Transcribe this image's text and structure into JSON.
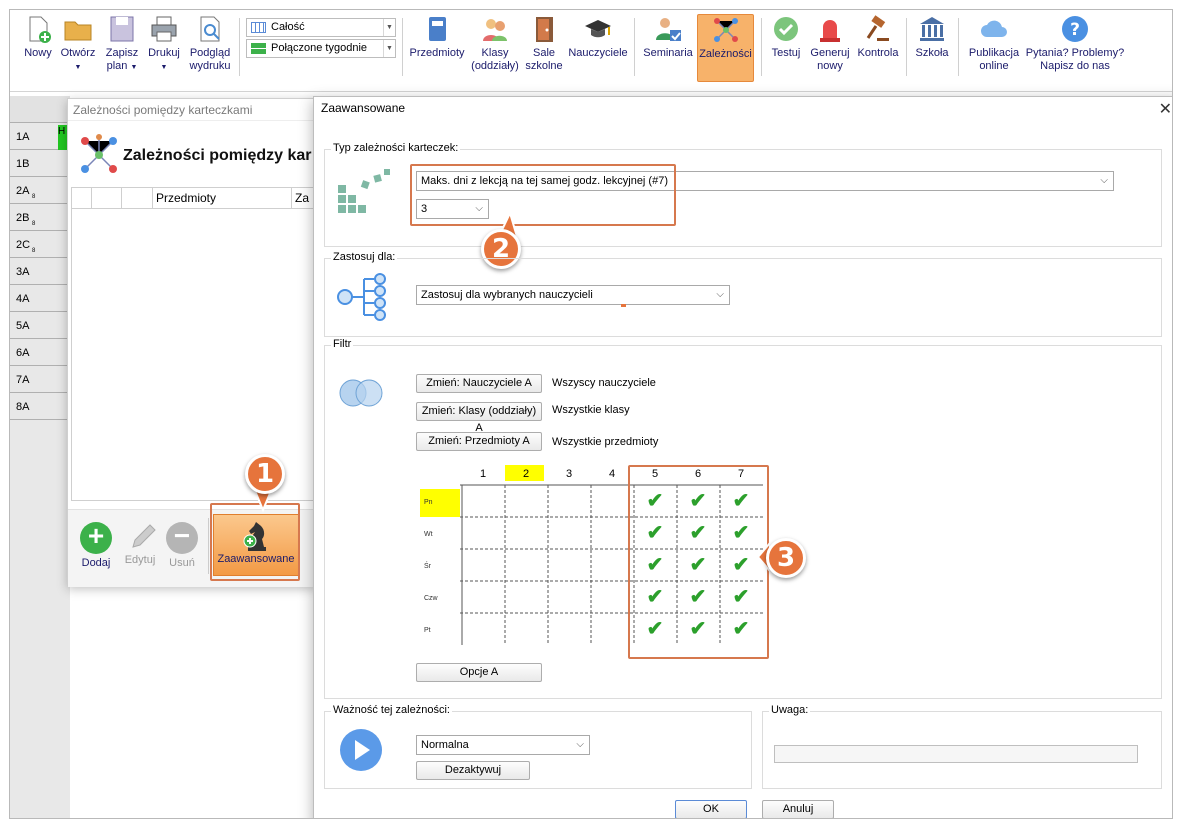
{
  "toolbar": {
    "nowy": "Nowy",
    "otworz": "Otwórz",
    "zapisz_line1": "Zapisz",
    "zapisz_line2": "plan",
    "drukuj": "Drukuj",
    "podglad_line1": "Podgląd",
    "podglad_line2": "wydruku",
    "combo1": "Całość",
    "combo2": "Połączone tygodnie",
    "przedmioty": "Przedmioty",
    "klasy_line1": "Klasy",
    "klasy_line2": "(oddziały)",
    "sale_line1": "Sale",
    "sale_line2": "szkolne",
    "nauczyciele": "Nauczyciele",
    "seminaria": "Seminaria",
    "zaleznosci": "Zależności",
    "testuj": "Testuj",
    "generuj_line1": "Generuj",
    "generuj_line2": "nowy",
    "kontrola": "Kontrola",
    "szkola": "Szkoła",
    "publikacja_line1": "Publikacja",
    "publikacja_line2": "online",
    "pytania_line1": "Pytania? Problemy?",
    "pytania_line2": "Napisz do nas"
  },
  "classes": [
    "1A",
    "1B",
    "2A",
    "2B",
    "2C",
    "3A",
    "4A",
    "5A",
    "6A",
    "7A",
    "8A"
  ],
  "class_subs": {
    "2A": "8",
    "2B": "8",
    "2C": "8"
  },
  "dialog1": {
    "title": "Zależności pomiędzy karteczkami",
    "heading": "Zależności pomiędzy kar",
    "col_przedmioty": "Przedmioty",
    "col_za": "Za",
    "dodaj": "Dodaj",
    "edytuj": "Edytuj",
    "usun": "Usuń",
    "zaawansowane": "Zaawansowane",
    "first_cell": "H"
  },
  "dialog2": {
    "title": "Zaawansowane",
    "typ_label": "Typ zależności karteczek:",
    "typ_value": "Maks. dni z lekcją na tej samej godz. lekcyjnej (#7)",
    "typ_num": "3",
    "zastosuj_label": "Zastosuj dla:",
    "zastosuj_value": "Zastosuj dla wybranych nauczycieli",
    "filtr_label": "Filtr",
    "btn_nauczyciele": "Zmień: Nauczyciele A",
    "btn_klasy": "Zmień: Klasy (oddziały) A",
    "btn_przedmioty": "Zmień: Przedmioty A",
    "lbl_nauczyciele": "Wszyscy nauczyciele",
    "lbl_klasy": "Wszystkie klasy",
    "lbl_przedmioty": "Wszystkie przedmioty",
    "periods": [
      "1",
      "2",
      "3",
      "4",
      "5",
      "6",
      "7"
    ],
    "days": [
      "Pn",
      "Wt",
      "Śr",
      "Czw",
      "Pt"
    ],
    "checked_periods": [
      "5",
      "6",
      "7"
    ],
    "opcje": "Opcje A",
    "waznosc_label": "Ważność tej zależności:",
    "waznosc_value": "Normalna",
    "dezaktywuj": "Dezaktywuj",
    "uwaga_label": "Uwaga:",
    "ok": "OK",
    "anuluj": "Anuluj"
  },
  "badges": {
    "b1": "1",
    "b2": "2",
    "b3": "3"
  },
  "colors": {
    "accent_orange": "#e6743c",
    "highlight_yellow": "#ffff00",
    "check_green": "#2ca02c",
    "active_tab": "#f7b26a"
  }
}
